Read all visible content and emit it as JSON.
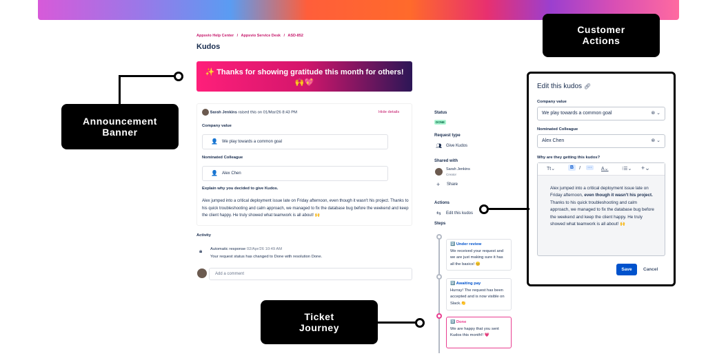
{
  "breadcrumb": [
    "Appsvio Help Center",
    "/",
    "Appsvio Service Desk",
    "/",
    "ASD-852"
  ],
  "page_title": "Kudos",
  "banner": {
    "line1": "✨ Thanks for showing gratitude this month for others!",
    "line2": "🙌💖"
  },
  "request": {
    "author": "Sarah Jenkins",
    "raised_text": "raised this on 01/Mar/26 8:43 PM",
    "hide_details": "Hide details",
    "company_value_label": "Company value",
    "company_value": "We play towards a common goal",
    "company_value_emoji": "👤",
    "colleague_label": "Nominated Colleague",
    "colleague": "Alex Chen",
    "colleague_emoji": "👤",
    "explain_label": "Explain why you decided to give Kudos.",
    "explain_text": "Alex jumped into a critical deployment issue late on Friday afternoon, even though it wasn't his project. Thanks to his quick troubleshooting and calm approach, we managed to fix the database bug before the weekend and keep the client happy. He truly showed what teamwork is all about! 🙌"
  },
  "activity": {
    "label": "Activity",
    "auto_title": "Automatic response",
    "auto_time": "02/Apr/26 10:49 AM",
    "auto_text": "Your request status has changed to Done with resolution Done.",
    "comment_placeholder": "Add a comment"
  },
  "sidebar": {
    "status_label": "Status",
    "status_value": "DONE",
    "request_type_label": "Request type",
    "request_type_value": "Give Kudos",
    "shared_label": "Shared with",
    "shared_name": "Sarah Jenkins",
    "shared_role": "Creator",
    "share": "Share",
    "actions_label": "Actions",
    "edit_kudos": "Edit this kudos",
    "steps_label": "Steps"
  },
  "steps": [
    {
      "title": "2️⃣ Under review",
      "text": "We received your request and we are just making sure it has all the basics! 😊"
    },
    {
      "title": "2️⃣ Awaiting pay",
      "text": "Hurray! The request has been accepted and is now visible on Slack.👏"
    },
    {
      "title": "3️⃣ Done",
      "text": "We are happy that you sent Kudos this month!! 💗"
    }
  ],
  "modal": {
    "title": "Edit this kudos",
    "company_value_label": "Company value",
    "company_value": "We play towards a common goal",
    "colleague_label": "Nominated Colleague",
    "colleague": "Alex Chen",
    "why_label": "Why are they getting this kudos?",
    "toolbar_text": "Tt",
    "text_before": "Alex jumped into a critical deployment issue late on Friday afternoon, ",
    "text_bold": "even though it wasn't his project.",
    "text_after": " Thanks to his quick troubleshooting and calm approach, we managed to fix the database bug before the weekend and keep the client happy. He truly showed what teamwork is all about! 🙌",
    "save": "Save",
    "cancel": "Cancel"
  },
  "callouts": {
    "customer_actions": "Customer\nActions",
    "announcement_banner": "Announcement\nBanner",
    "ticket_journey": "Ticket\nJourney"
  },
  "colors": {
    "accent": "#c5166a",
    "primary": "#0052cc",
    "done_bg": "#abf5d1"
  }
}
